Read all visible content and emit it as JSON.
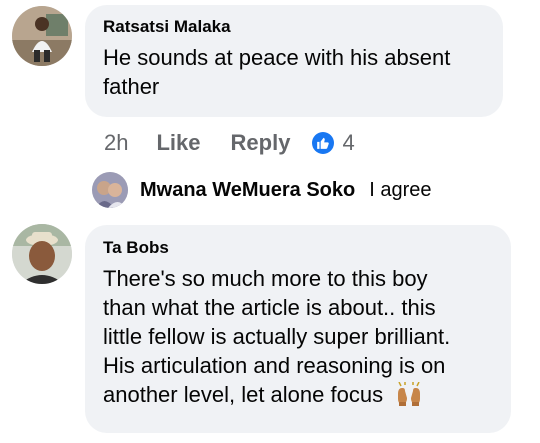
{
  "comments": [
    {
      "author": "Ratsatsi Malaka",
      "text_lines": [
        "He sounds at peace with his absent",
        "father"
      ],
      "time": "2h",
      "like_label": "Like",
      "reply_label": "Reply",
      "reaction_count": "4",
      "reaction_icon": "thumbs-up-icon"
    },
    {
      "author": "Ta Bobs",
      "text_lines": [
        "There's so much more to this boy",
        "than what the article is about.. this",
        "little fellow is actually super brilliant.",
        "His articulation and reasoning is on",
        "another level, let alone focus"
      ],
      "emoji_icon": "raised-hands-emoji"
    }
  ],
  "reply": {
    "author": "Mwana WeMuera Soko",
    "text": "I agree"
  },
  "colors": {
    "bubble": "#f0f2f5",
    "meta_text": "#65676b",
    "like_blue": "#1877f2"
  }
}
